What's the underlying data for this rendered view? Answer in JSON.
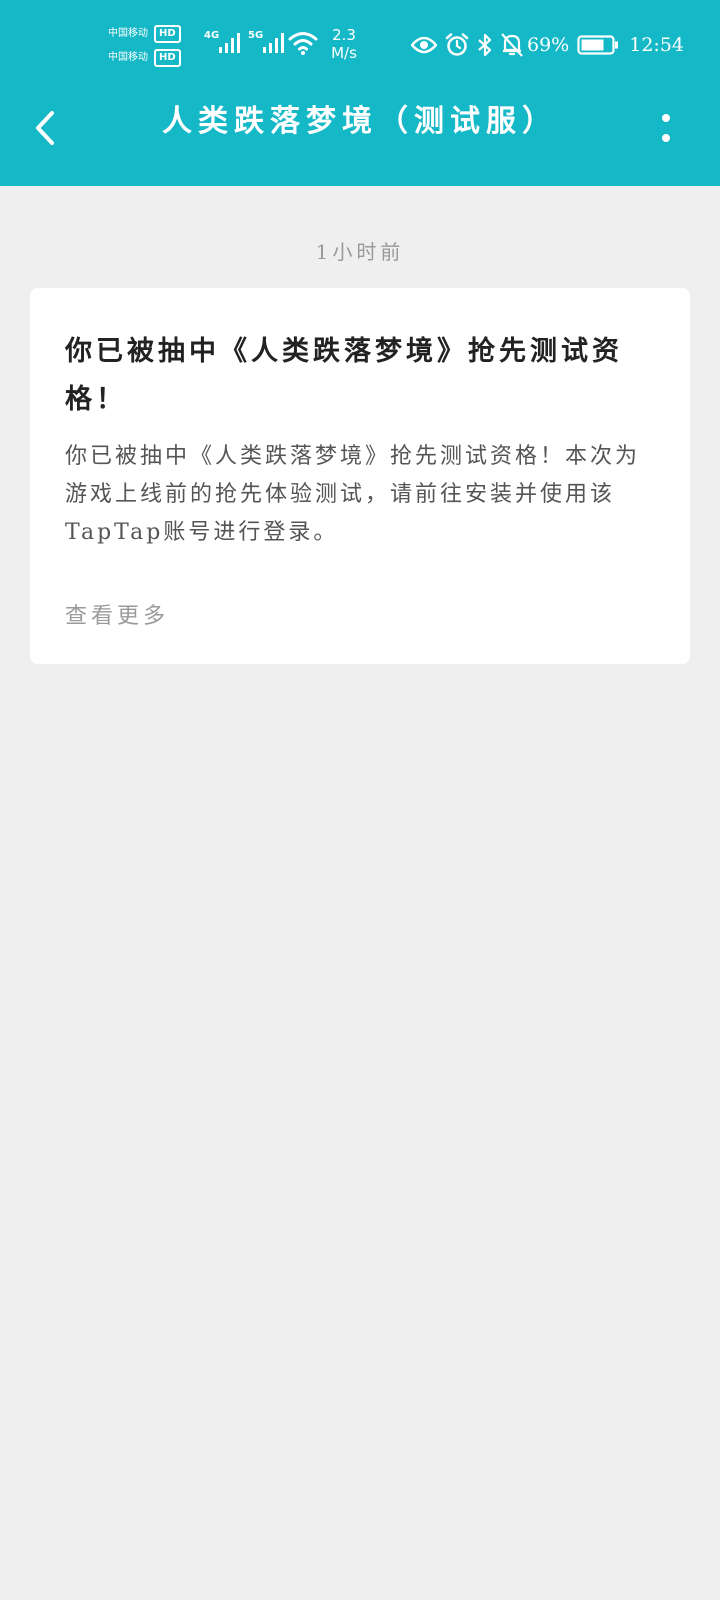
{
  "status_bar": {
    "carriers": [
      {
        "name": "中国移动",
        "badge": "HD"
      },
      {
        "name": "中国移动",
        "badge": "HD"
      }
    ],
    "network_types": [
      "4G",
      "5G"
    ],
    "speed_value": "2.3",
    "speed_unit": "M/s",
    "battery_percent": "69%",
    "time": "12:54",
    "icons": [
      "eye-icon",
      "alarm-icon",
      "bluetooth-icon",
      "bell-muted-icon",
      "battery-icon"
    ]
  },
  "header": {
    "title": "人类跌落梦境（测试服）",
    "back_icon": "chevron-left-icon",
    "menu_icon": "more-vertical-icon"
  },
  "message": {
    "timestamp": "1小时前",
    "title": "你已被抽中《人类跌落梦境》抢先测试资格！",
    "body": "你已被抽中《人类跌落梦境》抢先测试资格！本次为游戏上线前的抢先体验测试，请前往安装并使用该TapTap账号进行登录。",
    "more_label": "查看更多"
  },
  "colors": {
    "header_bg": "#15b8c6",
    "page_bg": "#efefef",
    "card_bg": "#ffffff",
    "title_text": "#222222",
    "body_text": "#555555",
    "muted_text": "#9a9a9a"
  }
}
